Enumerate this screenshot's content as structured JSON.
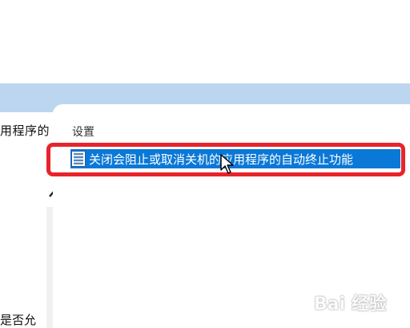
{
  "left_pane": {
    "text_top": "用程序的",
    "text_bottom": "是否允"
  },
  "right_panel": {
    "section_header": "设置",
    "selected_item": {
      "label": "关闭会阻止或取消关机的应用程序的自动终止功能",
      "icon": "policy-setting-icon"
    }
  },
  "watermark": {
    "text": "Bai 经验"
  },
  "colors": {
    "selection": "#0a78d7",
    "highlight_border": "#e8232a",
    "header_band": "#bcd6ef"
  }
}
